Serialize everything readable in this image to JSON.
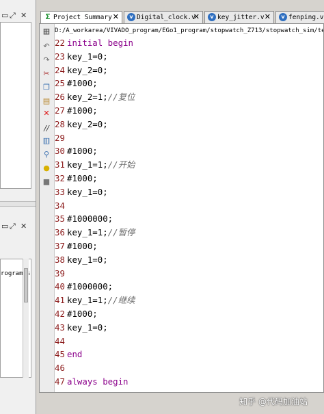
{
  "tabs": [
    {
      "label": "Project Summary",
      "icon": "sigma-icon"
    },
    {
      "label": "Digital_clock.v",
      "icon": "verilog-file-icon"
    },
    {
      "label": "key_jitter.v",
      "icon": "verilog-file-icon"
    },
    {
      "label": "fenping.v",
      "icon": "verilog-file-icon"
    }
  ],
  "editor": {
    "file_path": "D:/A_workarea/VIVADO_program/EGo1_program/stopwatch_Z713/stopwatch_sim/testb",
    "lines": [
      {
        "num": "22",
        "code": "initial begin",
        "comment": ""
      },
      {
        "num": "23",
        "code": "key_1=0;",
        "comment": ""
      },
      {
        "num": "24",
        "code": "key_2=0;",
        "comment": ""
      },
      {
        "num": "25",
        "code": "#1000;",
        "comment": ""
      },
      {
        "num": "26",
        "code": "key_2=1;",
        "comment": "//复位"
      },
      {
        "num": "27",
        "code": "#1000;",
        "comment": ""
      },
      {
        "num": "28",
        "code": "key_2=0;",
        "comment": ""
      },
      {
        "num": "29",
        "code": "",
        "comment": ""
      },
      {
        "num": "30",
        "code": "#1000;",
        "comment": ""
      },
      {
        "num": "31",
        "code": "key_1=1;",
        "comment": "//开始"
      },
      {
        "num": "32",
        "code": "#1000;",
        "comment": ""
      },
      {
        "num": "33",
        "code": "key_1=0;",
        "comment": ""
      },
      {
        "num": "34",
        "code": "",
        "comment": ""
      },
      {
        "num": "35",
        "code": "#1000000;",
        "comment": ""
      },
      {
        "num": "36",
        "code": "key_1=1;",
        "comment": "//暂停"
      },
      {
        "num": "37",
        "code": "#1000;",
        "comment": ""
      },
      {
        "num": "38",
        "code": "key_1=0;",
        "comment": ""
      },
      {
        "num": "39",
        "code": "",
        "comment": ""
      },
      {
        "num": "40",
        "code": "#1000000;",
        "comment": ""
      },
      {
        "num": "41",
        "code": "key_1=1;",
        "comment": "//继续"
      },
      {
        "num": "42",
        "code": "#1000;",
        "comment": ""
      },
      {
        "num": "43",
        "code": "key_1=0;",
        "comment": ""
      },
      {
        "num": "44",
        "code": "",
        "comment": ""
      },
      {
        "num": "45",
        "code": "end",
        "comment": ""
      },
      {
        "num": "46",
        "code": "",
        "comment": ""
      },
      {
        "num": "47",
        "code": "always begin",
        "comment": ""
      }
    ]
  },
  "left_panel": {
    "lower_text": "rogram/s"
  },
  "toolbar_icons": [
    "save-icon",
    "undo-icon",
    "redo-icon",
    "cut-icon",
    "copy-icon",
    "paste-icon",
    "delete-icon",
    "comment-icon",
    "select-all-icon",
    "find-icon",
    "hint-icon",
    "settings-icon"
  ],
  "watermark": "知乎 @代码加油站"
}
